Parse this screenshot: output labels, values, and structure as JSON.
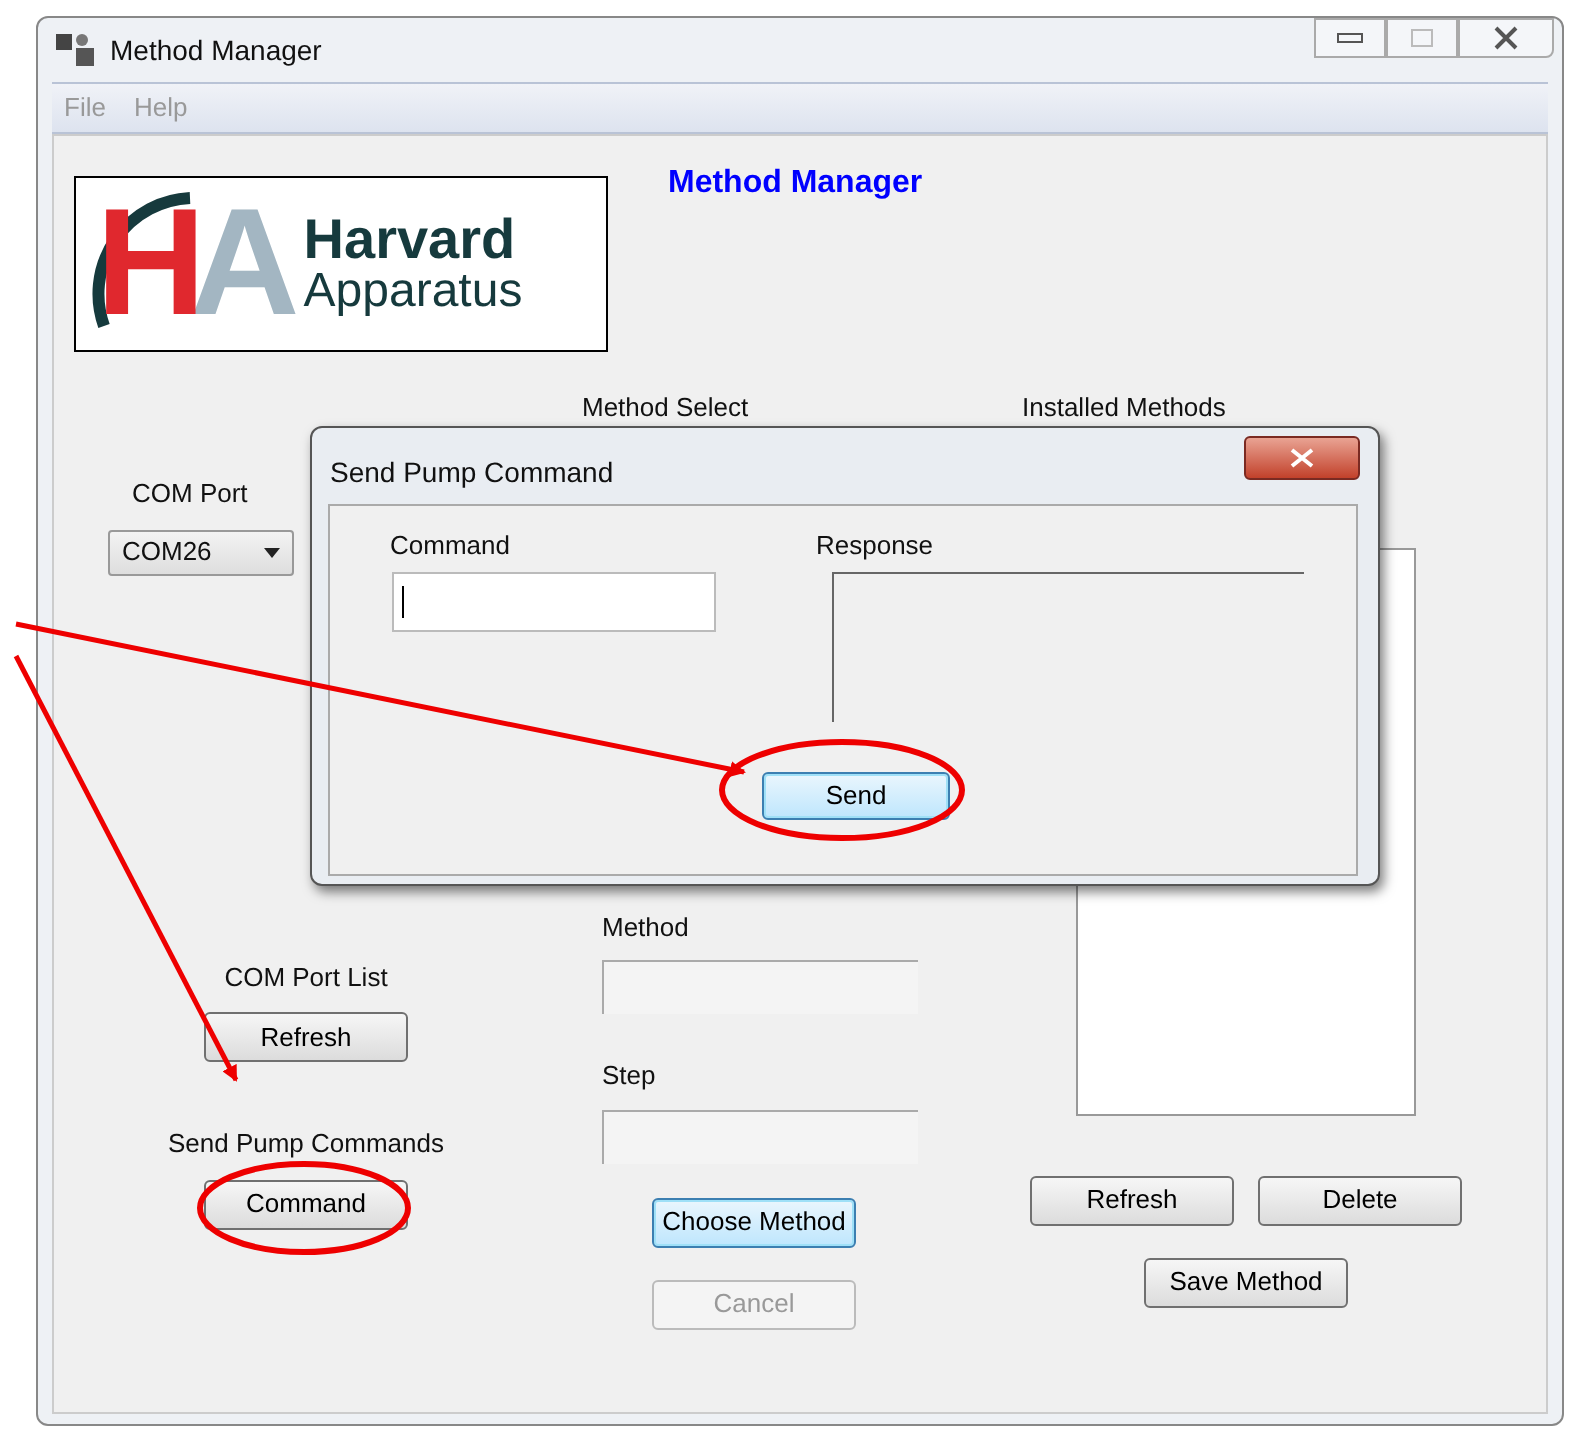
{
  "window": {
    "title": "Method Manager"
  },
  "menu": [
    {
      "label": "File",
      "disabled": true
    },
    {
      "label": "Help",
      "disabled": true
    }
  ],
  "logo": {
    "mark": [
      "H",
      "A"
    ],
    "name": [
      "Harvard",
      "Apparatus"
    ]
  },
  "heading": "Method Manager",
  "left": {
    "com_port_label": "COM Port",
    "com_port_value": "COM26",
    "com_list_label": "COM Port List",
    "refresh_button": "Refresh",
    "send_label": "Send Pump Commands",
    "command_button": "Command"
  },
  "middle": {
    "method_select_label": "Method Select",
    "method_label": "Method",
    "step_label": "Step",
    "buttons": [
      {
        "label": "Choose Method",
        "focused": true,
        "disabled": false
      },
      {
        "label": "Cancel",
        "focused": false,
        "disabled": true
      }
    ]
  },
  "right": {
    "installed_label": "Installed Methods",
    "buttons": [
      {
        "label": "Refresh"
      },
      {
        "label": "Delete"
      }
    ],
    "save_button": "Save Method"
  },
  "dialog": {
    "title": "Send Pump Command",
    "command_label": "Command",
    "command_focused": true,
    "response_label": "Response",
    "send_button": "Send"
  }
}
